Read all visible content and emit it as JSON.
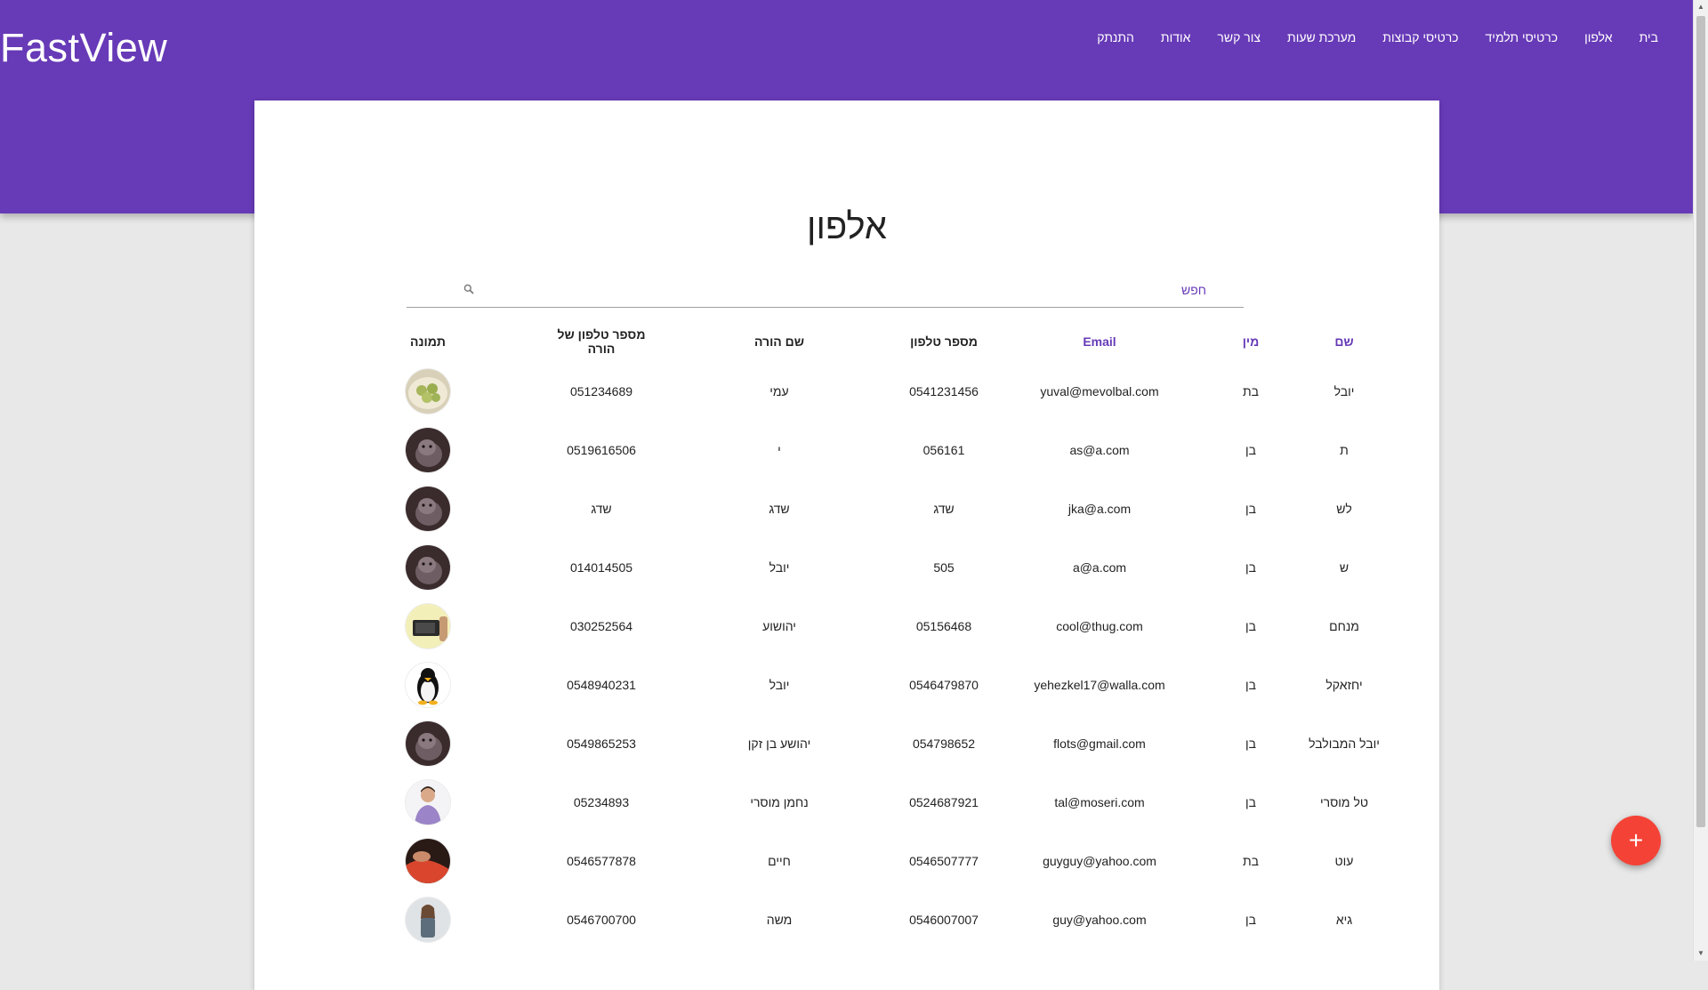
{
  "app": {
    "brand": "FastView"
  },
  "nav": [
    {
      "label": "בית",
      "icon": ""
    },
    {
      "label": "אלפון"
    },
    {
      "label": "כרטיסי תלמיד"
    },
    {
      "label": "כרטיסי קבוצות"
    },
    {
      "label": "מערכת שעות"
    },
    {
      "label": "צור קשר"
    },
    {
      "label": "אודות"
    },
    {
      "label": "התנתק"
    }
  ],
  "page": {
    "title": "אלפון"
  },
  "search": {
    "placeholder": "חפש",
    "icon": "search-icon"
  },
  "table": {
    "headers": {
      "name": "שם",
      "gender": "מין",
      "email": "Email",
      "phone": "מספר טלפון",
      "parent_name": "שם הורה",
      "parent_phone": "מספר טלפון של הורה",
      "photo": "תמונה"
    },
    "rows": [
      {
        "name": "יובל",
        "gender": "בת",
        "email": "yuval@mevolbal.com",
        "phone": "0541231456",
        "parent_name": "עמי",
        "parent_phone": "051234689",
        "photo": "food-photo"
      },
      {
        "name": "ת",
        "gender": "בן",
        "email": "as@a.com",
        "phone": "056161",
        "parent_name": "י",
        "parent_phone": "0519616506",
        "photo": "cat-photo"
      },
      {
        "name": "לש",
        "gender": "בן",
        "email": "jka@a.com",
        "phone": "שדג",
        "parent_name": "שדג",
        "parent_phone": "שדג",
        "photo": "cat-photo"
      },
      {
        "name": "ש",
        "gender": "בן",
        "email": "a@a.com",
        "phone": "505",
        "parent_name": "יובל",
        "parent_phone": "014014505",
        "photo": "cat-photo"
      },
      {
        "name": "מנחם",
        "gender": "בן",
        "email": "cool@thug.com",
        "phone": "05156468",
        "parent_name": "יהושוע",
        "parent_phone": "030252564",
        "photo": "device-photo"
      },
      {
        "name": "יחזאקל",
        "gender": "בן",
        "email": "yehezkel17@walla.com",
        "phone": "0546479870",
        "parent_name": "יובל",
        "parent_phone": "0548940231",
        "photo": "penguin-photo"
      },
      {
        "name": "יובל המבולבל",
        "gender": "בן",
        "email": "flots@gmail.com",
        "phone": "054798652",
        "parent_name": "יהושע בן זקן",
        "parent_phone": "0549865253",
        "photo": "cat-photo"
      },
      {
        "name": "טל מוסרי",
        "gender": "בן",
        "email": "tal@moseri.com",
        "phone": "0524687921",
        "parent_name": "נחמן מוסרי",
        "parent_phone": "05234893",
        "photo": "person-photo"
      },
      {
        "name": "עוט",
        "gender": "בת",
        "email": "guyguy@yahoo.com",
        "phone": "0546507777",
        "parent_name": "חיים",
        "parent_phone": "0546577878",
        "photo": "red-photo"
      },
      {
        "name": "גיא",
        "gender": "בן",
        "email": "guy@yahoo.com",
        "phone": "0546007007",
        "parent_name": "משה",
        "parent_phone": "0546700700",
        "photo": "woman-photo"
      }
    ]
  },
  "fab": {
    "label": "+",
    "icon": "plus-icon"
  },
  "colors": {
    "primary": "#673ab7",
    "accent": "#f44336",
    "background": "#e8e8e8"
  }
}
